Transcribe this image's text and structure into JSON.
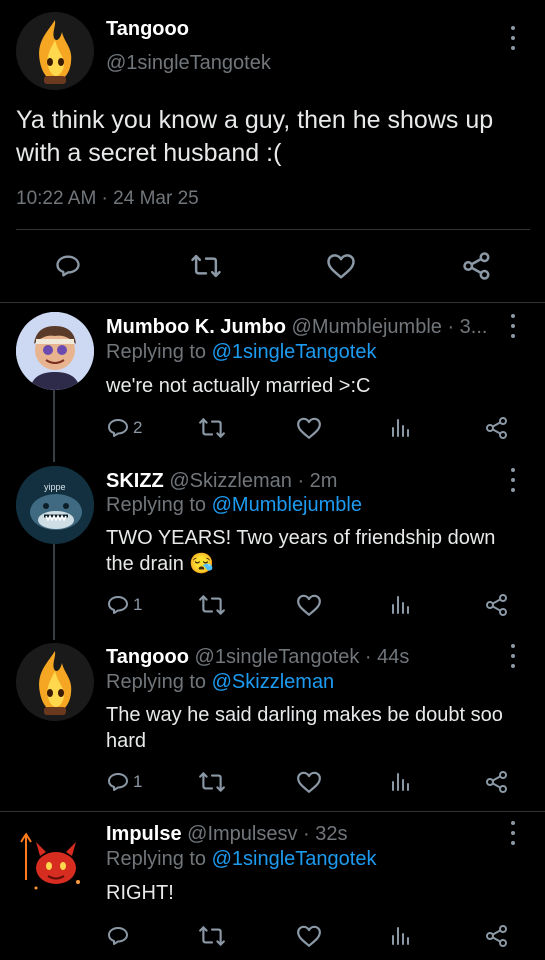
{
  "main_tweet": {
    "name": "Tangooo",
    "handle": "@1singleTangotek",
    "text": "Ya think you know a guy, then he shows up with a secret husband :(",
    "timestamp": "10:22 AM · 24 Mar 25"
  },
  "replies": [
    {
      "name": "Mumboo K. Jumbo",
      "handle_time": "@Mumblejumble · 3...",
      "replying_prefix": "Replying to ",
      "replying_to": "@1singleTangotek",
      "text": "we're not actually married >:C",
      "reply_count": "2"
    },
    {
      "name": "SKIZZ",
      "handle_time": "@Skizzleman · 2m",
      "avatar_text": "yippe",
      "replying_prefix": "Replying to ",
      "replying_to": "@Mumblejumble",
      "text": "TWO YEARS! Two years of friendship down the drain 😪",
      "reply_count": "1"
    },
    {
      "name": "Tangooo",
      "handle_time": "@1singleTangotek · 44s",
      "replying_prefix": "Replying to ",
      "replying_to": "@Skizzleman",
      "text": "The way he said darling makes be doubt soo hard",
      "reply_count": "1"
    },
    {
      "name": "Impulse",
      "handle_time": "@Impulsesv · 32s",
      "replying_prefix": "Replying to ",
      "replying_to": "@1singleTangotek",
      "text": "RIGHT!",
      "reply_count": ""
    }
  ],
  "icons": {
    "reply": "reply-icon",
    "retweet": "retweet-icon",
    "like": "heart-icon",
    "stats": "stats-icon",
    "share": "share-icon",
    "more": "more-icon"
  },
  "colors": {
    "background": "#000000",
    "link": "#1d9bf0",
    "muted": "#71767b",
    "icon": "#8b98a5"
  }
}
